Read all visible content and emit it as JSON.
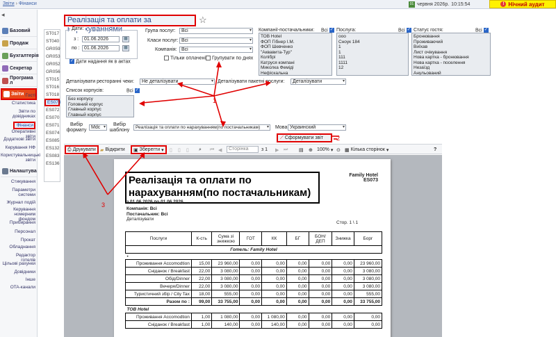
{
  "topbar": {
    "breadcrumb_section": "Звіти",
    "breadcrumb_sep": " › ",
    "breadcrumb_page": "Фінанси",
    "date_day": "01",
    "date_text": "червня 2026р.",
    "time": "10:15:54",
    "audit_label": "Нічний аудит"
  },
  "sidebar": {
    "main": [
      {
        "label": "Базовий",
        "color": "#5b7fb8"
      },
      {
        "label": "Продаж",
        "color": "#c8a24a"
      },
      {
        "label": "Бухгалтерія",
        "color": "#6aa05a"
      },
      {
        "label": "Секретар",
        "color": "#8f6ab8"
      },
      {
        "label": "Програма л",
        "color": "#c05050"
      },
      {
        "label": "Звіти",
        "color": "#ffffff"
      }
    ],
    "reports_sub": [
      "Гості",
      "Статистика",
      "Звіти по довідниках",
      "Фінанси",
      "Оперативні звіти",
      "Додаткові звіти",
      "Керування НФ",
      "Користувальницькі звіти"
    ],
    "settings_label": "Налаштува",
    "settings_sub": [
      "Стикування",
      "Параметри системи",
      "Журнал подій",
      "Керування номерним фондом",
      "Прибирання",
      "Персонал",
      "Прокат",
      "Обладнання",
      "Редактор готелів",
      "Цільові рахунки",
      "Довідники",
      "Інше",
      "OTA-канали"
    ]
  },
  "codes": [
    "ST017",
    "ST040",
    "GR059",
    "GR053",
    "GR052",
    "GR056",
    "ST015",
    "ST016",
    "ST018",
    "ES073",
    "ES072",
    "ES070",
    "ES071",
    "ES074",
    "ES085",
    "ES132",
    "ES083",
    "ES136"
  ],
  "form": {
    "title": "Реалізація та оплати за нарахуваннями",
    "dates_legend": "Дати:",
    "from_label": "з :",
    "from_value": "01.06.2026",
    "to_label": "по :",
    "to_value": "01.06.2026",
    "calendar_glyph": "▦",
    "by_acts_label": "Дати надання як в актах",
    "group_label": "Група послуг:",
    "group_value": "Всі",
    "class_label": "Класи послуг:",
    "class_value": "Всі",
    "company_label": "Компанія:",
    "company_value": "Всі",
    "only_paid_label": "Тільки оплачені",
    "by_days_label": "Групувати по днях",
    "suppliers_label": "Компанії-постачальники:",
    "suppliers_all": "Всі",
    "suppliers": [
      "ТОВ Hotel",
      "ФОП Гібнер І.М.",
      "ФОП Шевченко",
      "\"Аквавита-Тур\"",
      "Колібрі",
      "Катруся компані",
      "Миколка Феміді",
      "Нефіскальна"
    ],
    "services_label": "Послуга:",
    "services_all": "Всі",
    "services": [
      "ооо",
      "Сноук 184",
      "1",
      "1",
      "111",
      "1111",
      "12"
    ],
    "status_label": "Статус гостя:",
    "status_all": "Всі",
    "statuses": [
      "Бронювання",
      "Проживаючий",
      "Виїхав",
      "Лист очікування",
      "Нова картка - бронювання",
      "Нова картка - поселення",
      "Незаїзд",
      "Анульований"
    ],
    "restaurant_label": "Деталізувати ресторанні чеки:",
    "restaurant_value": "Не деталізувати",
    "packages_label": "Деталізувати пакетні послуги:",
    "packages_value": "Деталізувати",
    "buildings_label": "Список корпусів:",
    "buildings_all": "Всі",
    "buildings": [
      "Без корпусу",
      "Головний корпус",
      "Главный корпус",
      "Главный корпус"
    ],
    "format_label": "Вибір формату",
    "format_value": "Mdc",
    "template_label": "Вибір шаблону",
    "template_value": "Реалізація та оплати по нарахуванням(по постачальникам)",
    "lang_label": "Мова",
    "lang_value": "Украинский",
    "generate_label": "Сформувати звіт"
  },
  "toolbar": {
    "print": "Друкувати",
    "open": "Відкрити",
    "save": "Зберегти",
    "page_placeholder": "Сторінка",
    "page_total": "з 1",
    "zoom": "100%",
    "pages": "Кілька сторінок",
    "help": "?"
  },
  "report": {
    "title": "Реалізація та оплати по нарахуванням(по постачальникам)",
    "hotel": "Family Hotel",
    "code": "ES073",
    "period": "з 01.06.2026 по 01.06.2026",
    "company_line": "Компанія:   Всі",
    "supplier_line": "Постачальник: Всі",
    "detail_line": "Деталізувати",
    "page_line": "Стор. 1 \\ 1",
    "columns": [
      "Послуги",
      "К-сть",
      "Сума зі знижкою",
      "ГОТ",
      "КК",
      "БГ",
      "БОН/ДЕП",
      "Знижка",
      "Борг"
    ],
    "hotel_section": "Готель: Family Hotel",
    "bullet": "•",
    "rows1": [
      [
        "Проживання Accomodtion",
        "15,00",
        "23 960,00",
        "0,00",
        "0,00",
        "0,00",
        "0,00",
        "0,00",
        "23 960,00"
      ],
      [
        "Сніданок / Breakfast",
        "22,00",
        "3 080,00",
        "0,00",
        "0,00",
        "0,00",
        "0,00",
        "0,00",
        "3 080,00"
      ],
      [
        "Обід/Dinner",
        "22,00",
        "3 080,00",
        "0,00",
        "0,00",
        "0,00",
        "0,00",
        "0,00",
        "3 080,00"
      ],
      [
        "Вечеря/Dinner",
        "22,00",
        "3 080,00",
        "0,00",
        "0,00",
        "0,00",
        "0,00",
        "0,00",
        "3 080,00"
      ],
      [
        "Туристичний збір / City Tax",
        "18,00",
        "555,00",
        "0,00",
        "0,00",
        "0,00",
        "0,00",
        "0,00",
        "555,00"
      ]
    ],
    "total1": [
      "Разом по :",
      "99,00",
      "33 755,00",
      "0,00",
      "0,00",
      "0,00",
      "0,00",
      "0,00",
      "33 755,00"
    ],
    "supplier_section": "ТОВ Hotel",
    "rows2": [
      [
        "Проживання Accomodtion",
        "1,00",
        "1 080,00",
        "0,00",
        "1 080,00",
        "0,00",
        "0,00",
        "0,00",
        "0,00"
      ],
      [
        "Сніданок / Breakfast",
        "1,00",
        "140,00",
        "0,00",
        "140,00",
        "0,00",
        "0,00",
        "0,00",
        "0,00"
      ]
    ]
  },
  "annotations": {
    "a1": "1",
    "a2": "2",
    "a3": "3"
  }
}
